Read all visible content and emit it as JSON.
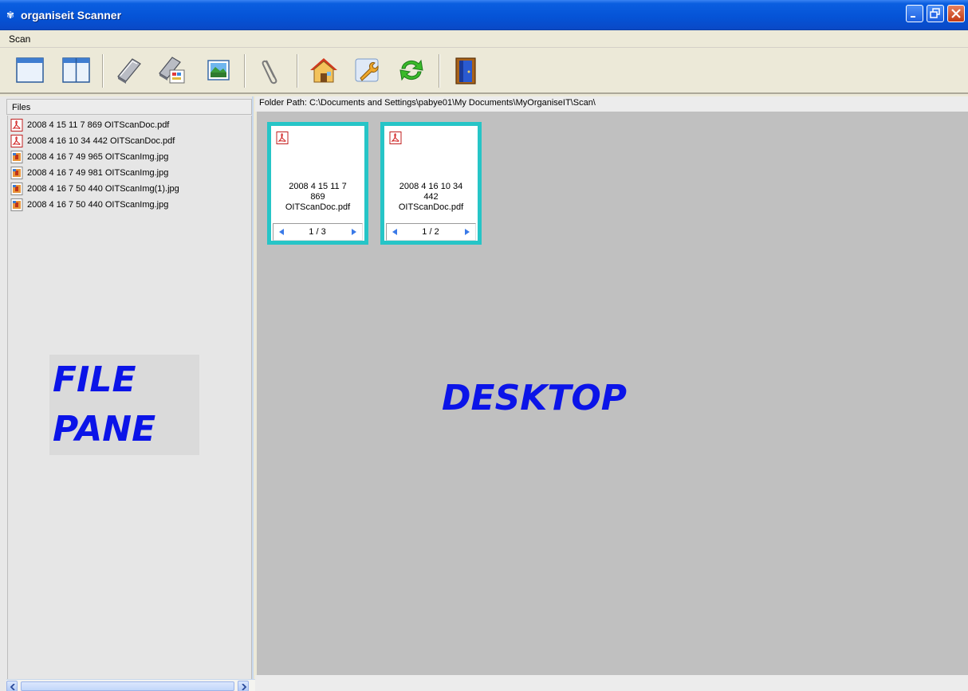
{
  "window": {
    "title": "organiseit Scanner"
  },
  "menu": {
    "items": [
      "Scan"
    ]
  },
  "toolbar": {
    "tools": [
      "layout-single-icon",
      "layout-split-icon",
      "scanner-icon",
      "scanner-color-icon",
      "image-icon",
      "paperclip-icon",
      "home-icon",
      "wrench-icon",
      "refresh-icon",
      "exit-door-icon"
    ]
  },
  "file_pane": {
    "header": "Files",
    "files": [
      {
        "name": "2008 4 15 11 7 869 OITScanDoc.pdf",
        "type": "pdf"
      },
      {
        "name": "2008 4 16 10 34 442 OITScanDoc.pdf",
        "type": "pdf"
      },
      {
        "name": "2008 4 16 7 49 965 OITScanImg.jpg",
        "type": "jpg"
      },
      {
        "name": "2008 4 16 7 49 981 OITScanImg.jpg",
        "type": "jpg"
      },
      {
        "name": "2008 4 16 7 50 440 OITScanImg(1).jpg",
        "type": "jpg"
      },
      {
        "name": "2008 4 16 7 50 440 OITScanImg.jpg",
        "type": "jpg"
      }
    ],
    "overlay_line1": "FILE",
    "overlay_line2": "PANE"
  },
  "desktop": {
    "folder_path_label": "Folder  Path:  C:\\Documents  and  Settings\\pabye01\\My  Documents\\MyOrganiseIT\\Scan\\",
    "overlay": "DESKTOP",
    "cards": [
      {
        "line1": "2008 4 15 11 7",
        "line2": "869",
        "line3": "OITScanDoc.pdf",
        "pager": "1 / 3"
      },
      {
        "line1": "2008 4 16 10 34",
        "line2": "442",
        "line3": "OITScanDoc.pdf",
        "pager": "1 / 2"
      }
    ]
  },
  "colors": {
    "titlebar": "#0553d6",
    "card_border": "#26c5c7",
    "overlay_text": "#0b14e8",
    "desktop_bg": "#c0c0c0"
  }
}
